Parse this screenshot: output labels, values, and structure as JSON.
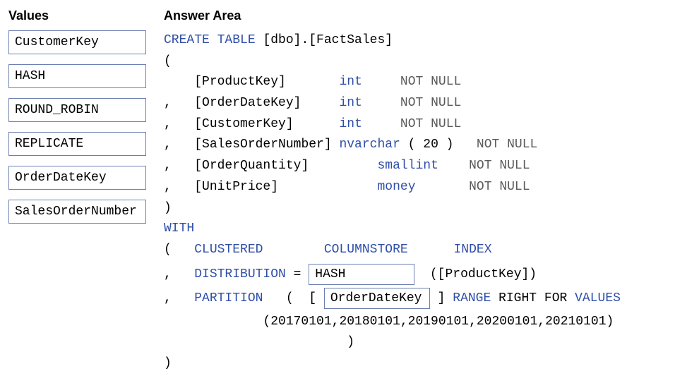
{
  "values_panel": {
    "title": "Values",
    "items": [
      {
        "label": "CustomerKey"
      },
      {
        "label": "HASH"
      },
      {
        "label": "ROUND_ROBIN"
      },
      {
        "label": "REPLICATE"
      },
      {
        "label": "OrderDateKey"
      },
      {
        "label": "SalesOrderNumber"
      }
    ]
  },
  "answer_panel": {
    "title": "Answer Area",
    "create1_kw": "CREATE TABLE ",
    "create1_obj": "[dbo].[FactSales]",
    "open_paren": "(",
    "col_prod_pre": "    ",
    "col_prod_name": "[ProductKey]",
    "col_prod_gap": "       ",
    "col_prod_type": "int",
    "col_prod_gap2": "     ",
    "col_prod_null": "NOT NULL",
    "col_odk_pre": ",   ",
    "col_odk_name": "[OrderDateKey]",
    "col_odk_gap": "     ",
    "col_odk_type": "int",
    "col_odk_gap2": "     ",
    "col_odk_null": "NOT NULL",
    "col_cust_pre": ",   ",
    "col_cust_name": "[CustomerKey]",
    "col_cust_gap": "      ",
    "col_cust_type": "int",
    "col_cust_gap2": "     ",
    "col_cust_null": "NOT NULL",
    "col_son_pre": ",   ",
    "col_son_name": "[SalesOrderNumber] ",
    "col_son_type": "nvarchar ",
    "col_son_paren": "( 20 )   ",
    "col_son_null": "NOT NULL",
    "col_qty_pre": ",   ",
    "col_qty_name": "[OrderQuantity]",
    "col_qty_gap": "         ",
    "col_qty_type": "smallint",
    "col_qty_gap2": "    ",
    "col_qty_null": "NOT NULL",
    "col_price_pre": ",   ",
    "col_price_name": "[UnitPrice]",
    "col_price_gap": "             ",
    "col_price_type": "money",
    "col_price_gap2": "       ",
    "col_price_null": "NOT NULL",
    "close_paren": ")",
    "with_kw": "WITH",
    "cci_open": "(   ",
    "cci_clustered": "CLUSTERED        ",
    "cci_columnstore": "COLUMNSTORE      ",
    "cci_index": "INDEX",
    "dist_pre": ",   ",
    "dist_kw": "DISTRIBUTION ",
    "dist_eq": "= ",
    "dist_drop": "HASH",
    "dist_post": "  ([ProductKey])",
    "part_pre": ",   ",
    "part_kw": "PARTITION   ",
    "part_open": "(  [ ",
    "part_drop": "OrderDateKey",
    "part_close": " ] ",
    "part_range": "RANGE ",
    "part_right": "RIGHT ",
    "part_for": "FOR ",
    "part_values": "VALUES",
    "part_list": "             (20170101,20180101,20190101,20200101,20210101)",
    "part_innerclose": "                        )",
    "final_close": ")"
  }
}
